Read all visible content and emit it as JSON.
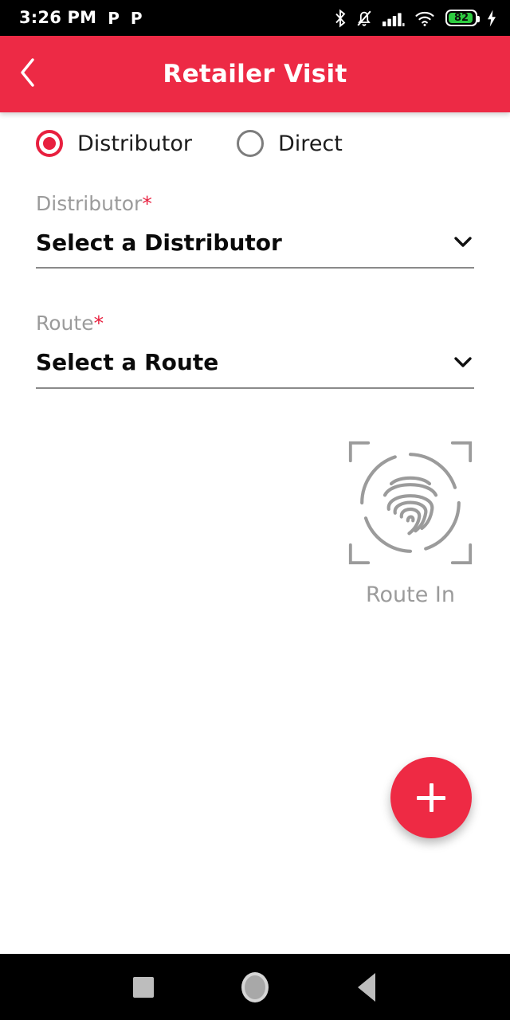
{
  "status_bar": {
    "time": "3:26 PM",
    "notification_icons": [
      "P",
      "P"
    ],
    "bluetooth_icon": "bluetooth-icon",
    "silent_icon": "bell-muted-icon",
    "signal_icon": "cellular-signal-icon",
    "wifi_icon": "wifi-icon",
    "battery_percent": "82",
    "charging_icon": "charging-bolt-icon"
  },
  "app_bar": {
    "back_icon": "chevron-left-icon",
    "title": "Retailer Visit",
    "background_color": "#ED2A45",
    "title_color": "#FFFFFF"
  },
  "form": {
    "visit_type": {
      "selected": "Distributor",
      "options": [
        {
          "label": "Distributor",
          "selected": true
        },
        {
          "label": "Direct",
          "selected": false
        }
      ],
      "selected_color": "#E8203F",
      "unselected_color": "#7D7D7D"
    },
    "fields": [
      {
        "label": "Distributor",
        "required_marker": "*",
        "value": "Select a Distributor",
        "dropdown_icon": "chevron-down-icon"
      },
      {
        "label": "Route",
        "required_marker": "*",
        "value": "Select a Route",
        "dropdown_icon": "chevron-down-icon"
      }
    ],
    "biometric": {
      "icon": "fingerprint-scan-icon",
      "caption": "Route In",
      "icon_color": "#9B9B9B"
    },
    "fab": {
      "icon": "plus-icon",
      "label": "+",
      "background_color": "#EE2A44"
    }
  },
  "nav_bar": {
    "recents_icon": "square-recents-icon",
    "home_icon": "circle-home-icon",
    "back_icon": "triangle-back-icon",
    "background_color": "#000000"
  }
}
